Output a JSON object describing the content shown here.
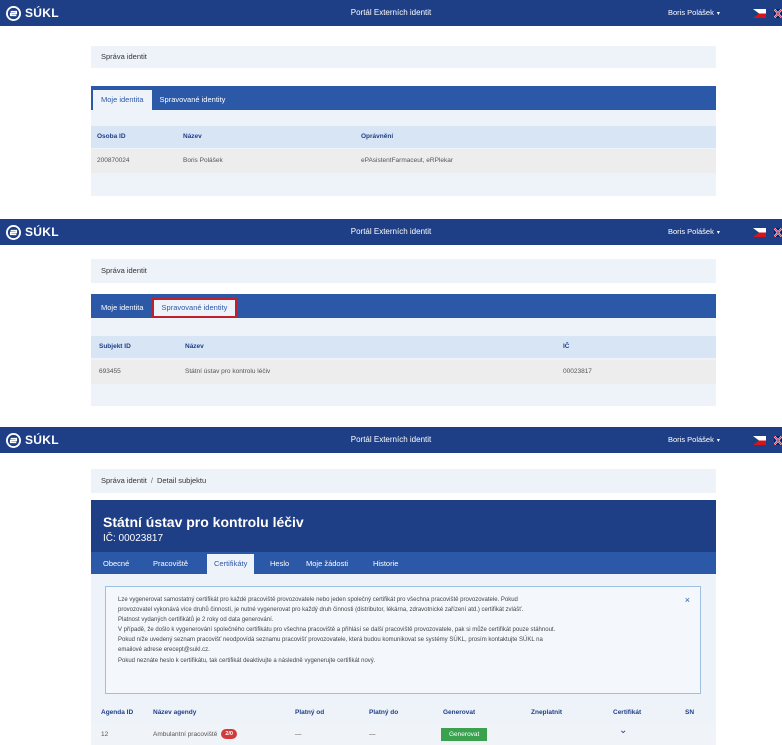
{
  "brand": {
    "name": "SÚKL"
  },
  "portal_title": "Portál Externích identit",
  "user": {
    "name": "Boris Polášek",
    "caret": "▾"
  },
  "colors": {
    "header": "#1e3f86",
    "tabbar": "#2c58a8",
    "panel": "#eef3fa",
    "highlight": "#c0202c",
    "generate": "#3aa14f"
  },
  "screens": [
    {
      "breadcrumb": "Správa identit",
      "tabs": [
        "Moje identita",
        "Spravované identity"
      ],
      "headers": [
        "Osoba ID",
        "Název",
        "Oprávnění"
      ],
      "row": [
        "200870024",
        "Boris Polášek",
        "ePAsistentFarmaceut, eRPlekar"
      ]
    },
    {
      "breadcrumb": "Správa identit",
      "tabs": [
        "Moje identita",
        "Spravované identity"
      ],
      "headers": [
        "Subjekt ID",
        "Název",
        "IČ"
      ],
      "row": [
        "693455",
        "Státní ústav pro kontrolu léčiv",
        "00023817"
      ]
    }
  ],
  "detail": {
    "breadcrumb": [
      "Správa identit",
      "/",
      "Detail subjektu"
    ],
    "name": "Státní ústav pro kontrolu léčiv",
    "ico": "IČ: 00023817",
    "tabs": [
      "Obecné",
      "Pracoviště",
      "Certifikáty",
      "Heslo",
      "Moje žádosti",
      "Historie"
    ],
    "info_lines": [
      "Lze vygenerovat samostatný certifikát pro každé pracoviště provozovatele nebo jeden společný certifikát pro všechna pracoviště provozovatele. Pokud",
      "provozovatel vykonává více druhů činností, je nutné vygenerovat pro každý druh činnosti (distributor, lékárna, zdravotnické zařízení atd.) certifikát zvlášť.",
      "Platnost vydaných certifikátů je 2 roky od data generování.",
      "V případě, že došlo k vygenerování společného certifikátu pro všechna pracoviště a přihlásí se další pracoviště provozovatele, pak si může certifikát pouze stáhnout.",
      "Pokud níže uvedený seznam pracovišť neodpovídá seznamu pracovišť provozovatele, která budou komunikovat se systémy SÚKL, prosím kontaktujte SÚKL na",
      "emailové adrese erecept@sukl.cz.",
      "Pokud neznáte heslo k certifikátu, tak certifikát deaktivujte a následně vygenerujte certifikát nový."
    ],
    "close": "×",
    "headers": [
      "Agenda ID",
      "Název agendy",
      "Platný od",
      "Platný do",
      "Generovat",
      "Zneplatnit",
      "Certifikát",
      "SN"
    ],
    "row": {
      "agenda_id": "12",
      "agenda_name": "Ambulantní pracoviště",
      "badge": "2/0",
      "valid_from": "—",
      "valid_to": "—",
      "generate": "Generovat",
      "cert_icon": "chevron-down-icon"
    }
  }
}
